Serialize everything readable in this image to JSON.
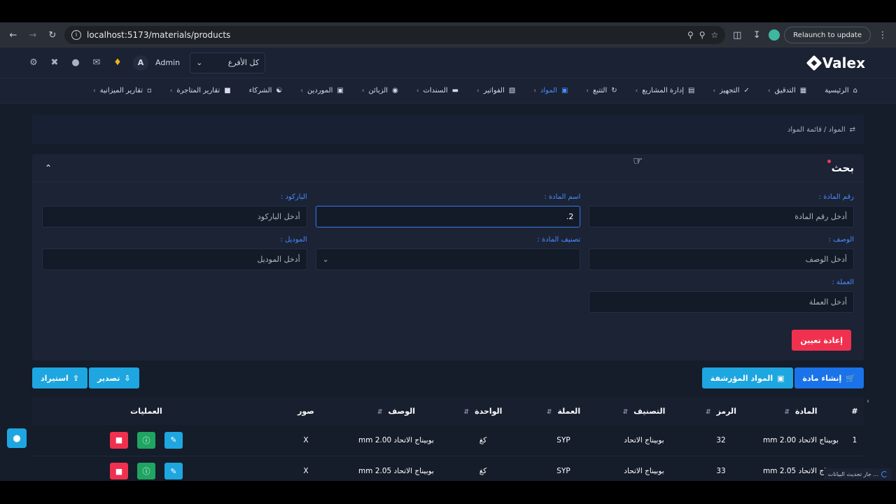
{
  "browser": {
    "url": "localhost:5173/materials/products",
    "relaunch_label": "Relaunch to update"
  },
  "header": {
    "user_initial": "A",
    "user_name": "Admin",
    "branch_select": "كل الأفرع",
    "logo_text": "Valex"
  },
  "nav": {
    "items": [
      {
        "label": "الرئيسية",
        "icon": "home-icon"
      },
      {
        "label": "التدقيق",
        "icon": "audit-icon"
      },
      {
        "label": "التجهيز",
        "icon": "check-icon"
      },
      {
        "label": "إدارة المشاريع",
        "icon": "projects-icon"
      },
      {
        "label": "التتبع",
        "icon": "tracking-icon"
      },
      {
        "label": "المواد",
        "icon": "materials-icon",
        "active": true
      },
      {
        "label": "الفواتير",
        "icon": "invoices-icon"
      },
      {
        "label": "السندات",
        "icon": "vouchers-icon"
      },
      {
        "label": "الزبائن",
        "icon": "customers-icon"
      },
      {
        "label": "الموردين",
        "icon": "suppliers-icon"
      },
      {
        "label": "الشركاء",
        "icon": "partners-icon"
      },
      {
        "label": "تقارير المتاجرة",
        "icon": "trading-reports-icon"
      },
      {
        "label": "تقارير الميزانية",
        "icon": "budget-reports-icon"
      }
    ]
  },
  "breadcrumb": "المواد / قائمة المواد",
  "search": {
    "title": "بحث",
    "fields": {
      "code": {
        "label": "رقم المادة :",
        "placeholder": "أدخل رقم المادة"
      },
      "name": {
        "label": "اسم المادة :",
        "value": "2."
      },
      "barcode": {
        "label": "الباركود :",
        "placeholder": "أدخل الباركود"
      },
      "description": {
        "label": "الوصف :",
        "placeholder": "أدخل الوصف"
      },
      "category": {
        "label": "تصنيف المادة :",
        "value": ""
      },
      "model": {
        "label": "الموديل :",
        "placeholder": "أدخل الموديل"
      },
      "currency": {
        "label": "العملة :",
        "placeholder": "أدخل العملة"
      }
    },
    "reset_label": "إعادة تعيين"
  },
  "actions": {
    "create": "إنشاء مادة",
    "archived": "المواد المؤرشفة",
    "export": "تصدير",
    "import": "استيراد"
  },
  "table": {
    "headers": [
      "#",
      "المادة",
      "الرمز",
      "التصنيف",
      "العملة",
      "الواحدة",
      "الوصف",
      "صور",
      "العمليات"
    ],
    "rows": [
      {
        "num": "1",
        "material": "بوبيناج الاتحاد 2.00 mm",
        "code": "32",
        "category": "بوبيناج الاتحاد",
        "currency": "SYP",
        "unit": "كغ",
        "description": "بوبيناج الاتحاد 2.00 mm",
        "images": "X"
      },
      {
        "num": "",
        "material": "بوبيناج الاتحاد 2.05 mm",
        "code": "33",
        "category": "بوبيناج الاتحاد",
        "currency": "SYP",
        "unit": "كغ",
        "description": "بوبيناج الاتحاد 2.05 mm",
        "images": "X"
      }
    ]
  },
  "status_toast": "جار تحديث البيانات ..."
}
